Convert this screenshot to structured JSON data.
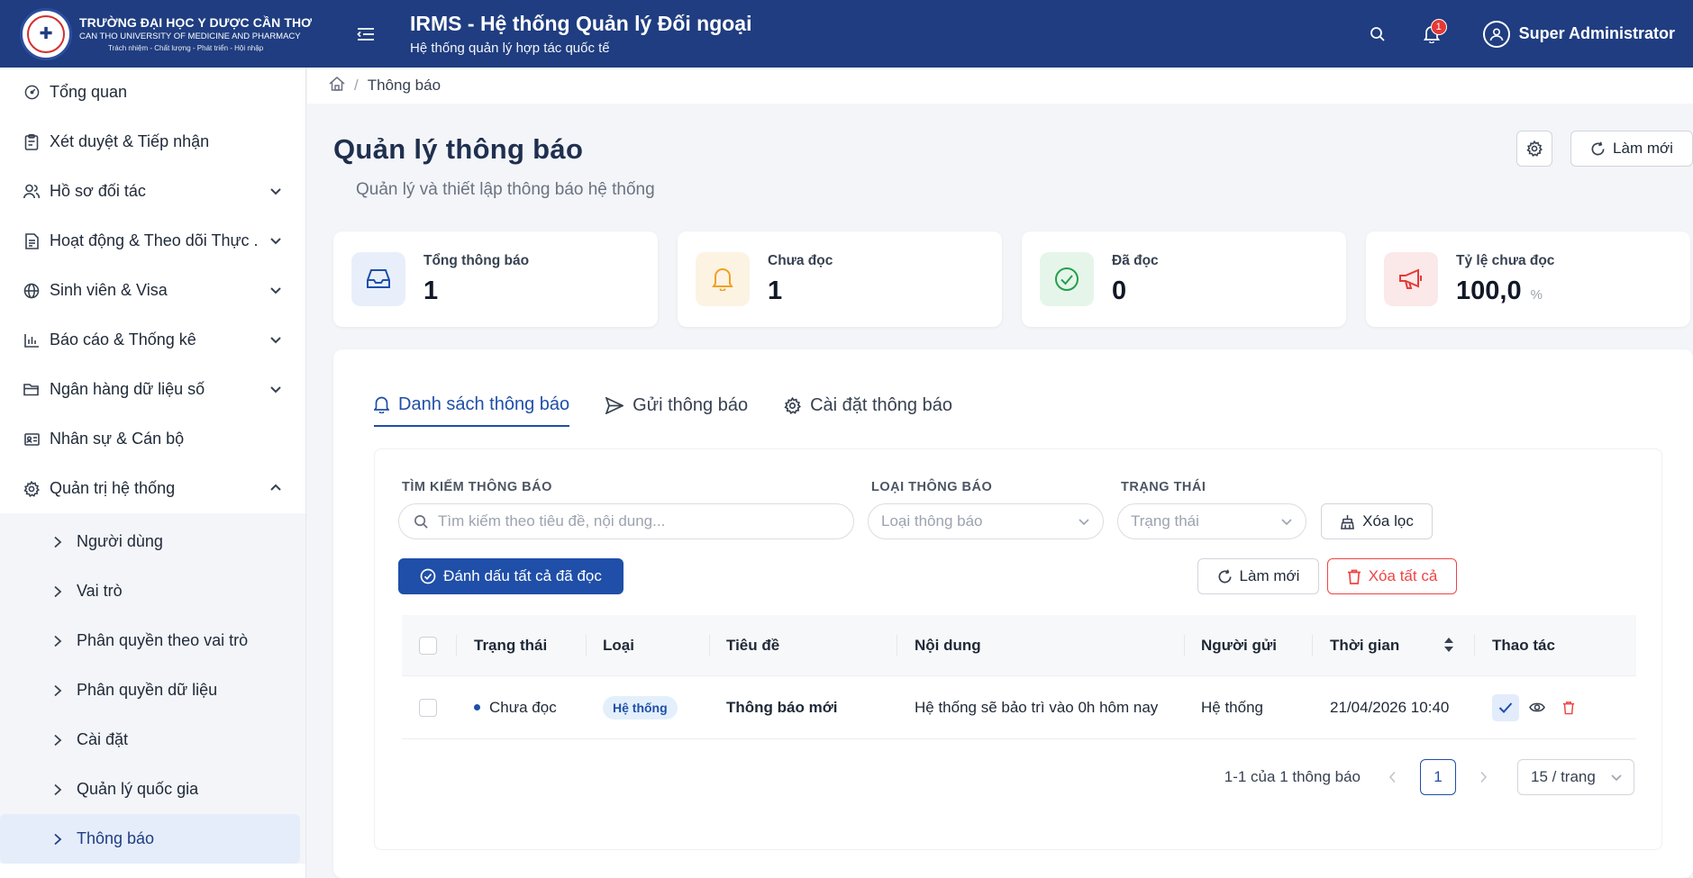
{
  "header": {
    "university_name": "TRƯỜNG ĐẠI HỌC Y DƯỢC CẦN THƠ",
    "university_name_en": "CAN THO UNIVERSITY OF MEDICINE AND PHARMACY",
    "university_motto": "Trách nhiệm - Chất lượng - Phát triển - Hội nhập",
    "app_title": "IRMS - Hệ thống Quản lý Đối ngoại",
    "app_subtitle": "Hệ thống quản lý hợp tác quốc tế",
    "notification_count": "1",
    "user_name": "Super Administrator"
  },
  "sidebar": {
    "items": [
      {
        "label": "Tổng quan",
        "icon": "dashboard-icon"
      },
      {
        "label": "Xét duyệt & Tiếp nhận",
        "icon": "clipboard-icon"
      },
      {
        "label": "Hồ sơ đối tác",
        "icon": "users-icon"
      },
      {
        "label": "Hoạt động & Theo dõi Thực ...",
        "icon": "document-icon"
      },
      {
        "label": "Sinh viên & Visa",
        "icon": "globe-icon"
      },
      {
        "label": "Báo cáo & Thống kê",
        "icon": "bar-chart-icon"
      },
      {
        "label": "Ngân hàng dữ liệu số",
        "icon": "folder-icon"
      },
      {
        "label": "Nhân sự & Cán bộ",
        "icon": "id-card-icon"
      },
      {
        "label": "Quản trị hệ thống",
        "icon": "gear-icon"
      }
    ],
    "sub_items": [
      {
        "label": "Người dùng"
      },
      {
        "label": "Vai trò"
      },
      {
        "label": "Phân quyền theo vai trò"
      },
      {
        "label": "Phân quyền dữ liệu"
      },
      {
        "label": "Cài đặt"
      },
      {
        "label": "Quản lý quốc gia"
      },
      {
        "label": "Thông báo"
      }
    ]
  },
  "breadcrumb": {
    "current": "Thông báo"
  },
  "page": {
    "title": "Quản lý thông báo",
    "subtitle": "Quản lý và thiết lập thông báo hệ thống",
    "refresh_label": "Làm mới"
  },
  "stats": [
    {
      "label": "Tổng thông báo",
      "value": "1",
      "icon": "inbox-icon",
      "color": "#1f4fa8"
    },
    {
      "label": "Chưa đọc",
      "value": "1",
      "icon": "bell-icon",
      "color": "#f0a020"
    },
    {
      "label": "Đã đọc",
      "value": "0",
      "icon": "check-circle-icon",
      "color": "#22a04b"
    },
    {
      "label": "Tỷ lệ chưa đọc",
      "value": "100,0",
      "unit": "%",
      "icon": "megaphone-icon",
      "color": "#e53935"
    }
  ],
  "tabs": [
    {
      "label": "Danh sách thông báo",
      "icon": "bell-icon"
    },
    {
      "label": "Gửi thông báo",
      "icon": "send-icon"
    },
    {
      "label": "Cài đặt thông báo",
      "icon": "gear-icon"
    }
  ],
  "filters": {
    "search_label": "TÌM KIẾM THÔNG BÁO",
    "search_placeholder": "Tìm kiếm theo tiêu đề, nội dung...",
    "type_label": "LOẠI THÔNG BÁO",
    "type_placeholder": "Loại thông báo",
    "status_label": "TRẠNG THÁI",
    "status_placeholder": "Trạng thái",
    "clear_label": "Xóa lọc"
  },
  "actions": {
    "mark_all_read": "Đánh dấu tất cả đã đọc",
    "refresh": "Làm mới",
    "delete_all": "Xóa tất cả"
  },
  "table": {
    "columns": [
      "Trạng thái",
      "Loại",
      "Tiêu đề",
      "Nội dung",
      "Người gửi",
      "Thời gian",
      "Thao tác"
    ],
    "rows": [
      {
        "status": "Chưa đọc",
        "type": "Hệ thống",
        "title": "Thông báo mới",
        "content": "Hệ thống sẽ bảo trì vào 0h hôm nay",
        "sender": "Hệ thống",
        "time": "21/04/2026 10:40"
      }
    ]
  },
  "pagination": {
    "total_text": "1-1 của 1 thông báo",
    "current_page": "1",
    "page_size": "15 / trang"
  },
  "colors": {
    "primary": "#1f4fa8",
    "header_bg": "#1f3d80",
    "danger": "#ef4444"
  }
}
